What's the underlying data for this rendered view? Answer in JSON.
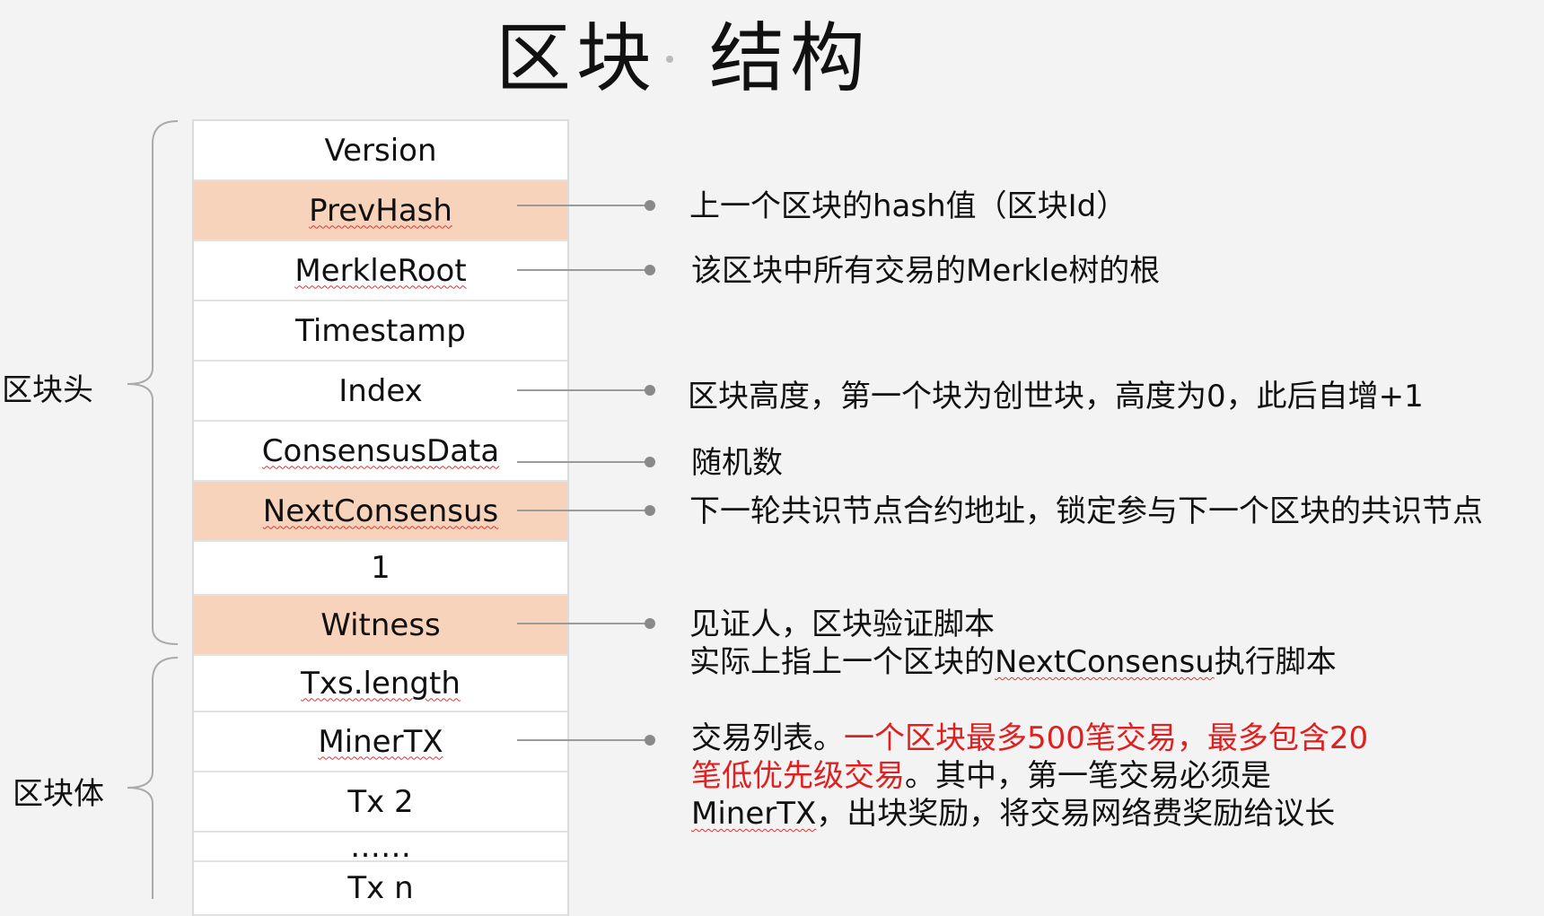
{
  "title": {
    "part1": "区块",
    "part2": "结构"
  },
  "sections": {
    "header_label": "区块头",
    "body_label": "区块体"
  },
  "fields": [
    {
      "label": "Version",
      "style": "white",
      "squiggle": false
    },
    {
      "label": "PrevHash",
      "style": "peach",
      "squiggle": true
    },
    {
      "label": "MerkleRoot",
      "style": "white",
      "squiggle": true
    },
    {
      "label": "Timestamp",
      "style": "white",
      "squiggle": false
    },
    {
      "label": "Index",
      "style": "white",
      "squiggle": false
    },
    {
      "label": "ConsensusData",
      "style": "white",
      "squiggle": true
    },
    {
      "label": "NextConsensus",
      "style": "peach",
      "squiggle": true
    },
    {
      "label": "1",
      "style": "white",
      "squiggle": false
    },
    {
      "label": "Witness",
      "style": "peach",
      "squiggle": false
    },
    {
      "label": "Txs.length",
      "style": "white",
      "squiggle": true
    },
    {
      "label": "MinerTX",
      "style": "white",
      "squiggle": true
    },
    {
      "label": "Tx 2",
      "style": "white",
      "squiggle": false
    },
    {
      "label": "……",
      "style": "white",
      "squiggle": false
    },
    {
      "label": "Tx n",
      "style": "white",
      "squiggle": false
    }
  ],
  "descriptions": {
    "prevhash": "上一个区块的hash值（区块Id）",
    "merkleroot": "该区块中所有交易的Merkle树的根",
    "index": "区块高度，第一个块为创世块，高度为0，此后自增+1",
    "consensusdata": "随机数",
    "nextconsensus": "下一轮共识节点合约地址，锁定参与下一个区块的共识节点",
    "witness_line1": "见证人，区块验证脚本",
    "witness_line2_pre": "实际上指上一个区块的",
    "witness_line2_term": "NextConsensu",
    "witness_line2_post": "执行脚本",
    "minertx_line1_pre": "交易列表。",
    "minertx_line1_red": "一个区块最多500笔交易，最多包含20",
    "minertx_line2_red": "笔低优先级交易",
    "minertx_line2_post": "。其中，第一笔交易必须是",
    "minertx_line3_term": "MinerTX",
    "minertx_line3_post": "，出块奖励，将交易网络费奖励给议长"
  },
  "colors": {
    "background": "#f3f3f3",
    "highlight_row": "#f8d3bc",
    "emphasis_text": "#e02020",
    "connector": "#9a9a9a"
  }
}
